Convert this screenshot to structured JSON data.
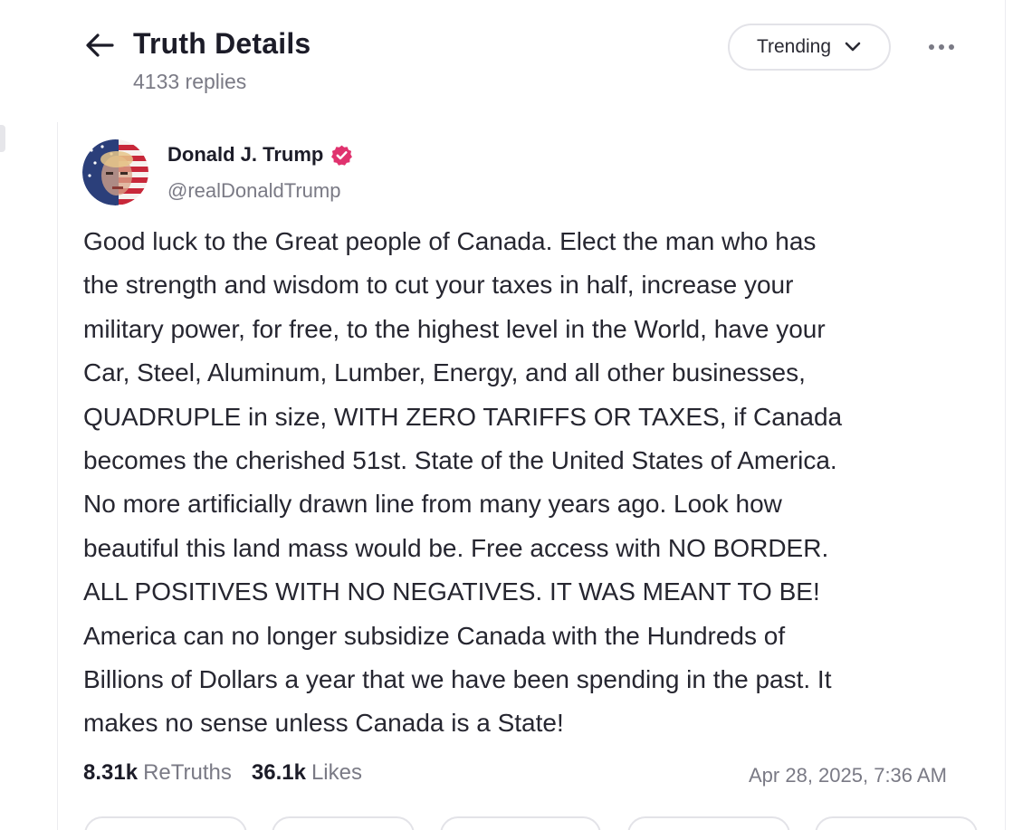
{
  "header": {
    "title": "Truth Details",
    "replies": "4133 replies",
    "sort_label": "Trending"
  },
  "post": {
    "author_name": "Donald J. Trump",
    "author_handle": "@realDonaldTrump",
    "lines": [
      "Good luck to the Great people of Canada. Elect the man who has",
      "the strength and wisdom to cut your taxes in half, increase your",
      "military power, for free, to the highest level in the World, have your",
      "Car, Steel, Aluminum, Lumber, Energy, and all other businesses,",
      "QUADRUPLE in size, WITH ZERO TARIFFS OR TAXES, if Canada",
      "becomes the cherished 51st. State of the United States of America.",
      "No more artificially drawn line from many years ago. Look how",
      "beautiful this land mass would be. Free access with NO BORDER.",
      "ALL POSITIVES WITH NO NEGATIVES. IT WAS MEANT TO BE!",
      "America can no longer subsidize Canada with the Hundreds of",
      "Billions of Dollars a year that we have been spending in the past. It",
      "makes no sense unless Canada is a State!"
    ],
    "retruths_count": "8.31k",
    "retruths_label": "ReTruths",
    "likes_count": "36.1k",
    "likes_label": "Likes",
    "timestamp": "Apr 28, 2025, 7:36 AM"
  },
  "icons": {
    "back": "arrow-left-icon",
    "sort": "chevron-down-icon",
    "more": "ellipsis-icon",
    "verified": "verified-badge-icon"
  },
  "colors": {
    "verified_badge": "#e0326e",
    "muted_text": "#7a7a85",
    "primary_text": "#1c1c28"
  }
}
